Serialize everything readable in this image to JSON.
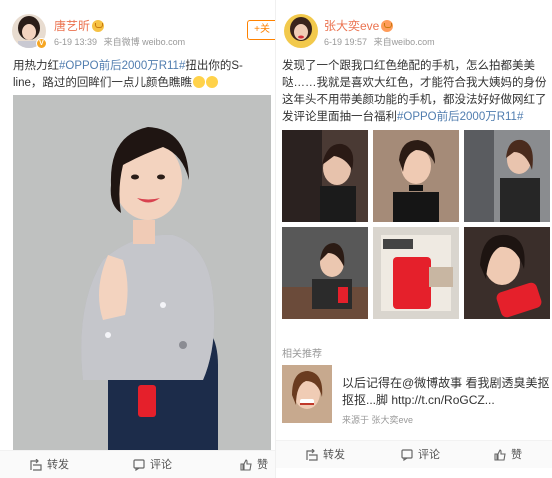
{
  "left_post": {
    "username": "唐艺昕",
    "timestamp": "6-19 13:39",
    "source": "来自微博 weibo.com",
    "follow_label": "+关",
    "text_before": "用热力红",
    "hashtag": "#OPPO前后2000万R11#",
    "text_after": "扭出你的S-line，路过的回眸们一点儿颜色瞧瞧",
    "actions": {
      "repost": "转发",
      "comment": "评论",
      "like": "赞"
    }
  },
  "right_post": {
    "username": "张大奕eve",
    "timestamp": "6-19 19:57",
    "source": "来自weibo.com",
    "text_body": "发现了一个跟我口红色绝配的手机，怎么拍都美美哒……我就是喜欢大红色，才能符合我大姨妈的身份这年头不用带美颜功能的手机，都没法好好做网红了发评论里面抽一台福利",
    "hashtag": "#OPPO前后2000万R11#",
    "recommend_title": "相关推荐",
    "recommend_text": "以后记得在@微博故事 看我剧透臭美抠抠抠...脚 http://t.cn/RoGCZ...",
    "recommend_source": "来源于 张大奕eve",
    "actions": {
      "repost": "转发",
      "comment": "评论",
      "like": "赞"
    }
  },
  "icons": [
    "verified-badge-icon",
    "crown-icon",
    "emoji-icon",
    "repost-icon",
    "comment-icon",
    "like-icon"
  ],
  "colors": {
    "username": "#eb7350",
    "hashtag": "#507daf",
    "follow": "#ff8200",
    "red_phone": "#e5202b"
  }
}
